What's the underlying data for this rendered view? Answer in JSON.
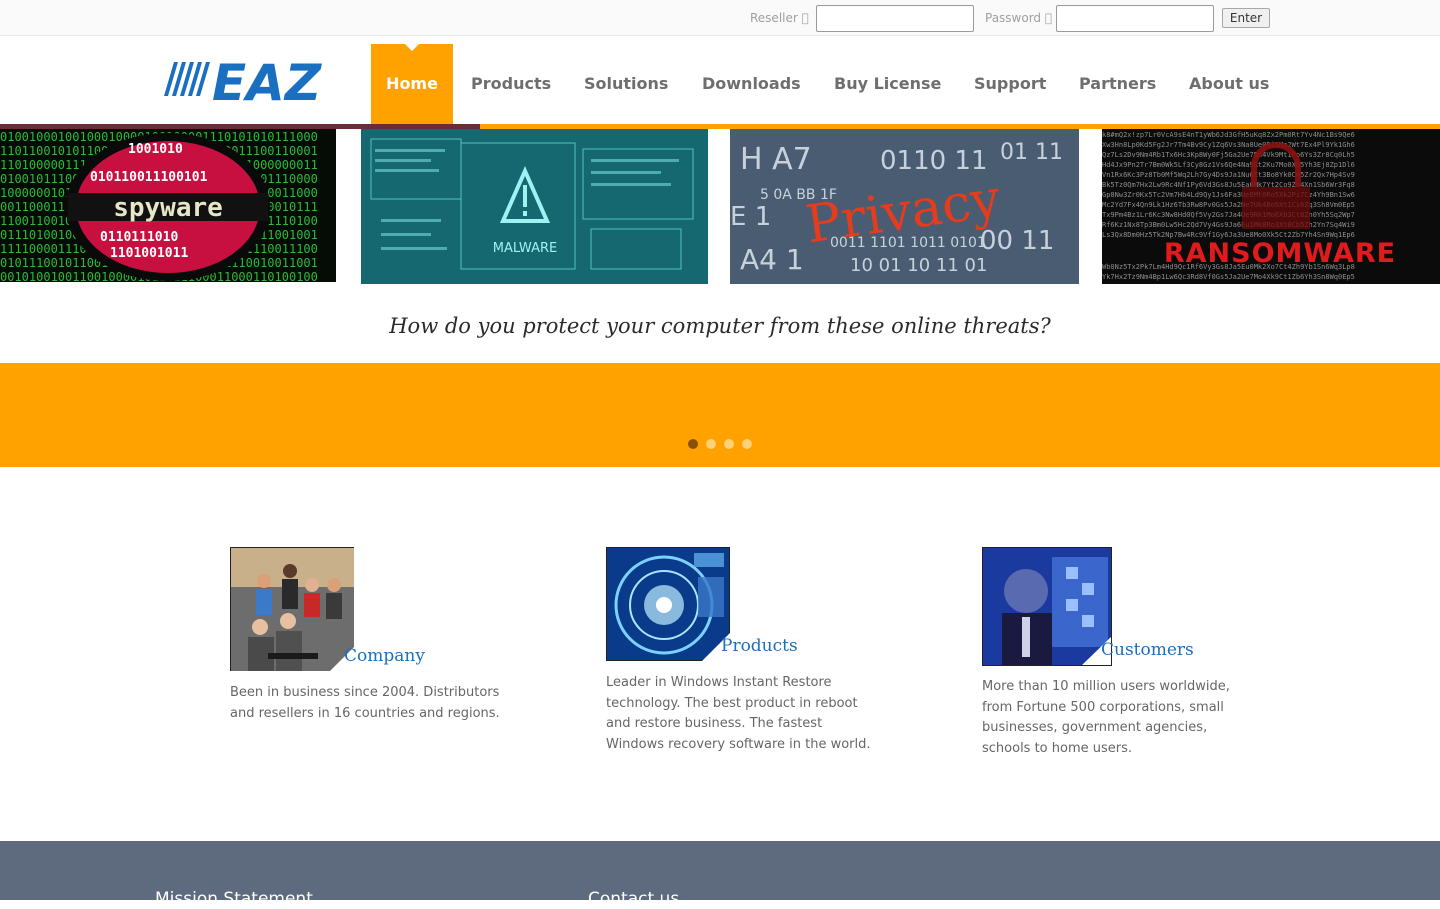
{
  "login": {
    "reseller_label": "Reseller ",
    "reseller_value": "",
    "password_label": "Password ",
    "password_value": "",
    "enter_label": "Enter"
  },
  "brand": {
    "logo_text": "EAZ",
    "logo_color": "#1a6fc0"
  },
  "nav": {
    "items": [
      {
        "label": "Home",
        "active": true
      },
      {
        "label": "Products"
      },
      {
        "label": "Solutions"
      },
      {
        "label": "Downloads"
      },
      {
        "label": "Buy License"
      },
      {
        "label": "Support"
      },
      {
        "label": "Partners"
      },
      {
        "label": "About us"
      }
    ]
  },
  "slider": {
    "tiles": [
      {
        "label": "spyware",
        "icon": "spyware-image"
      },
      {
        "label": "MALWARE",
        "icon": "malware-image"
      },
      {
        "label": "Privacy",
        "icon": "privacy-image"
      },
      {
        "label": "RANSOMWARE",
        "icon": "ransomware-image"
      }
    ],
    "tagline": "How do you protect your computer from these online threats?",
    "dots_total": 4,
    "dots_active_index": 0
  },
  "features": [
    {
      "heading": "Company",
      "text": "Been in business since 2004. Distributors and resellers in 16 countries and regions."
    },
    {
      "heading": "Products",
      "text": "Leader in Windows Instant Restore technology. The best product in reboot and restore business. The fastest Windows recovery software in the world."
    },
    {
      "heading": "Customers",
      "text": "More than 10 million users worldwide, from Fortune 500 corporations, small businesses, government agencies, schools to home users."
    }
  ],
  "footer": {
    "mission_heading": "Mission Statement",
    "contact_heading": "Contact us"
  },
  "colors": {
    "accent": "#ffa200",
    "accent_dark": "#6b2c3a",
    "footer_bg": "#5e6a7d",
    "heading_blue": "#1a6fc0"
  }
}
